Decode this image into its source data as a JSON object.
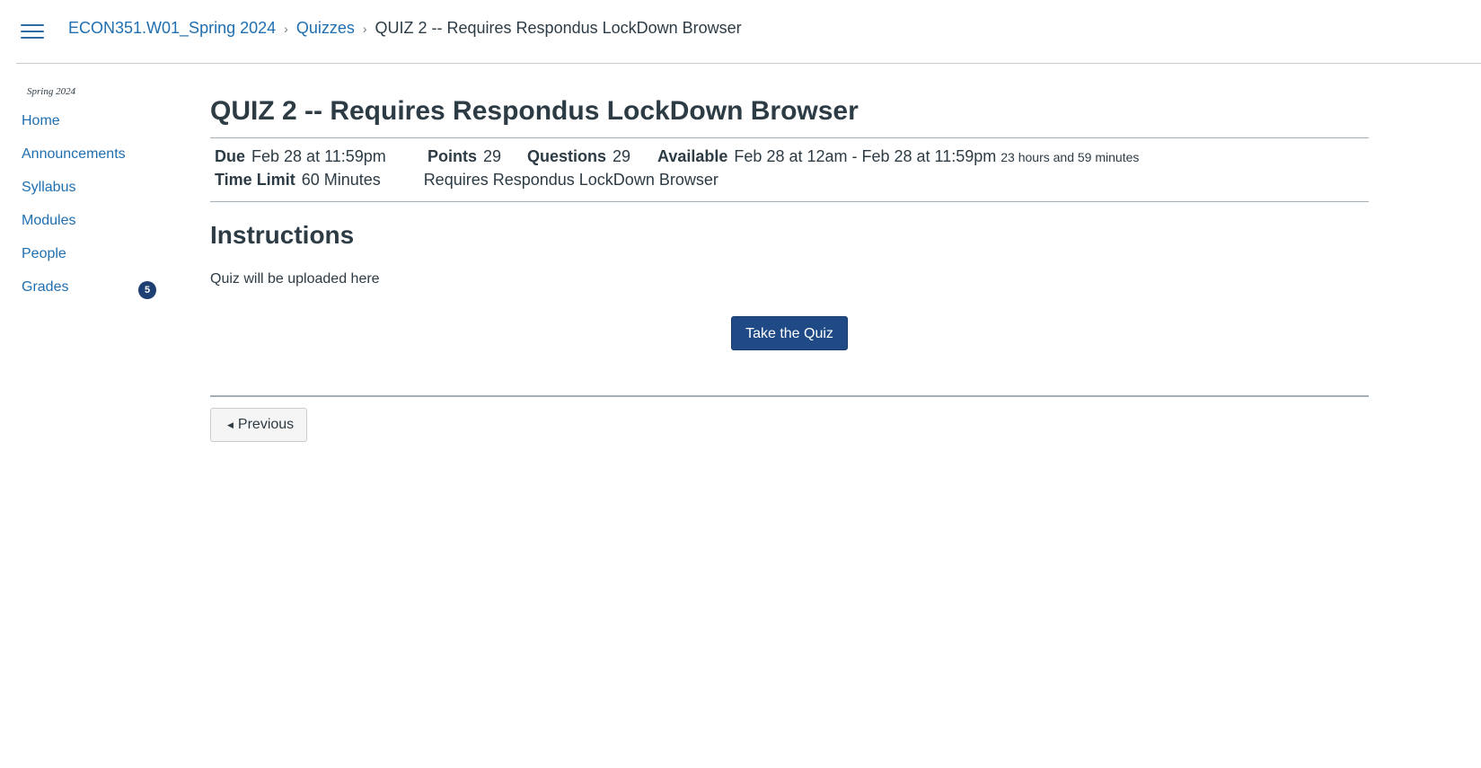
{
  "header": {
    "breadcrumb": {
      "course": "ECON351.W01_Spring 2024",
      "section": "Quizzes",
      "current": "QUIZ 2 -- Requires Respondus LockDown Browser"
    }
  },
  "sidebar": {
    "term": "Spring 2024",
    "items": [
      {
        "label": "Home"
      },
      {
        "label": "Announcements"
      },
      {
        "label": "Syllabus"
      },
      {
        "label": "Modules"
      },
      {
        "label": "People"
      },
      {
        "label": "Grades",
        "badge": "5"
      }
    ]
  },
  "quiz": {
    "title": "QUIZ 2 -- Requires Respondus LockDown Browser",
    "due_label": "Due",
    "due_value": "Feb 28 at 11:59pm",
    "points_label": "Points",
    "points_value": "29",
    "questions_label": "Questions",
    "questions_value": "29",
    "available_label": "Available",
    "available_value": "Feb 28 at 12am - Feb 28 at 11:59pm",
    "available_remaining": "23 hours and 59 minutes",
    "time_limit_label": "Time Limit",
    "time_limit_value": "60 Minutes",
    "lockdown_note": "Requires Respondus LockDown Browser",
    "instructions_heading": "Instructions",
    "instructions_body": "Quiz will be uploaded here",
    "take_button": "Take the Quiz",
    "previous_button": "Previous"
  },
  "colors": {
    "link": "#1f6fb0",
    "primary_button": "#1f4a85",
    "badge": "#1e3f72",
    "text": "#2d3b45"
  }
}
